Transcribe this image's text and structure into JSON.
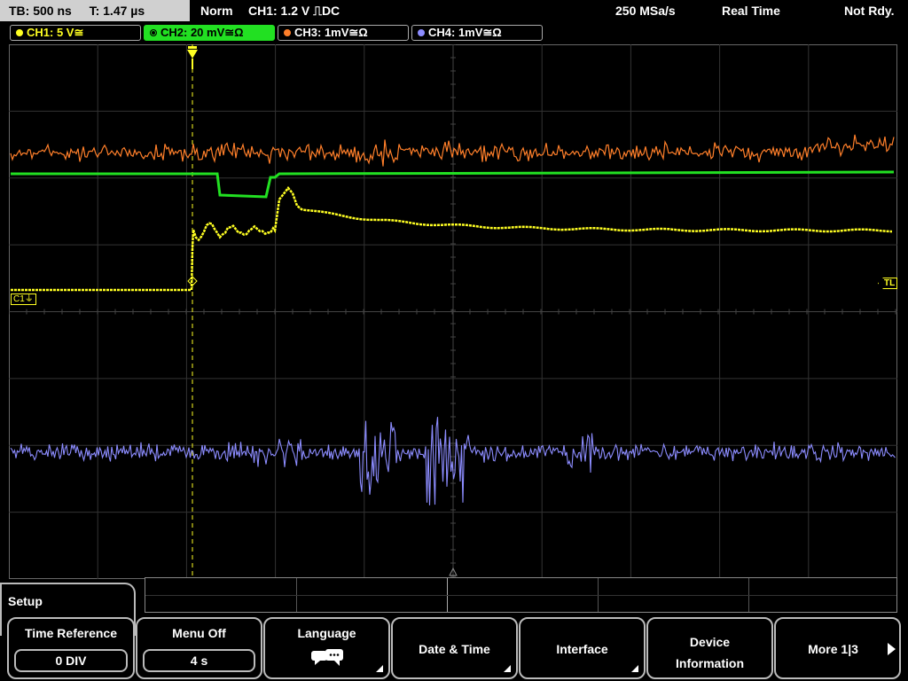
{
  "status_bar": {
    "timebase": "TB: 500 ns",
    "trigger_time": "T: 1.47 µs",
    "trigger_mode": "Norm",
    "trigger_source": "CH1: 1.2 V ⎍DC",
    "sample_rate": "250 MSa/s",
    "acq_mode": "Real Time",
    "state": "Not Rdy."
  },
  "channels": [
    {
      "label": "CH1: 5 V≅",
      "color": "#ffff22"
    },
    {
      "label": "CH2: 20 mV≅Ω",
      "color": "#22e022"
    },
    {
      "label": "CH3: 1mV≅Ω",
      "color": "#ff7f2a"
    },
    {
      "label": "CH4: 1mV≅Ω",
      "color": "#8c8cff"
    }
  ],
  "markers": {
    "ch1": "C1⏚",
    "tl": "TL"
  },
  "menu": {
    "title": "Setup",
    "buttons": [
      {
        "label": "Time Reference",
        "value": "0 DIV"
      },
      {
        "label": "Menu Off",
        "value": "4 s"
      },
      {
        "label": "Language",
        "icon": "speech-bubbles-icon"
      },
      {
        "label": "Date & Time"
      },
      {
        "label": "Interface"
      },
      {
        "label": "Device Information"
      },
      {
        "label": "More 1|3"
      }
    ]
  }
}
